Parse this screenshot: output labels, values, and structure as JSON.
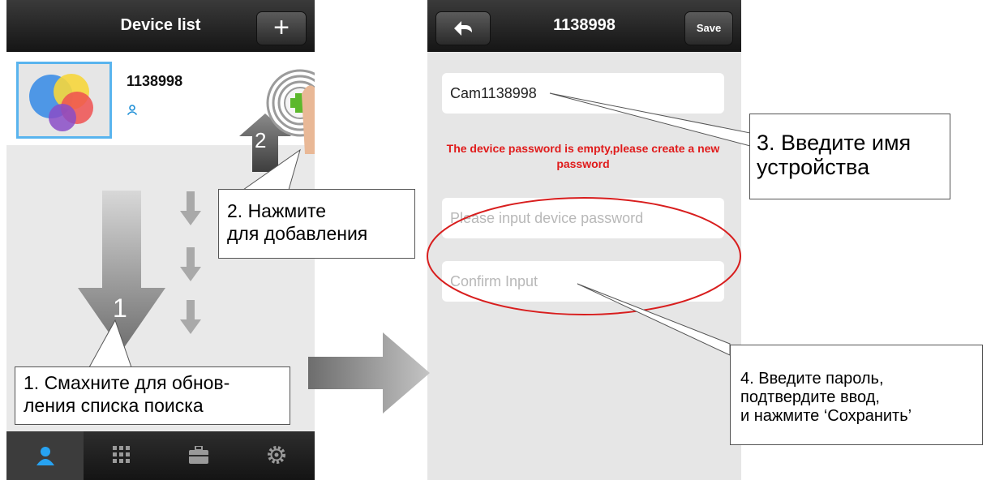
{
  "left_screen": {
    "nav_title": "Device list",
    "add_button": "+",
    "device_name": "1138998",
    "tabs": [
      "person-icon",
      "apps-grid-icon",
      "toolbox-icon",
      "gear-icon"
    ]
  },
  "right_screen": {
    "nav_title": "1138998",
    "save_label": "Save",
    "device_name_value": "Cam1138998",
    "warning": "The device password is empty,please create a new password",
    "password_placeholder": "Please input device password",
    "confirm_placeholder": "Confirm Input"
  },
  "annotations": {
    "step1_number": "1",
    "step1_line1": "1. Смахните для обнов-",
    "step1_line2": "ления списка поиска",
    "step2_number": "2",
    "step2_line1": "2. Нажмите",
    "step2_line2": "для добавления",
    "step3_line1": "3. Введите имя",
    "step3_line2": "устройства",
    "step4_line1": "4. Введите пароль,",
    "step4_line2": "подтвердите ввод,",
    "step4_line3": "и нажмите ‘Сохранить’"
  },
  "colors": {
    "accent_blue": "#1e8fd6",
    "warning_red": "#e01b1b",
    "oval_red": "#d81e1e",
    "plus_green": "#5cb82c"
  }
}
